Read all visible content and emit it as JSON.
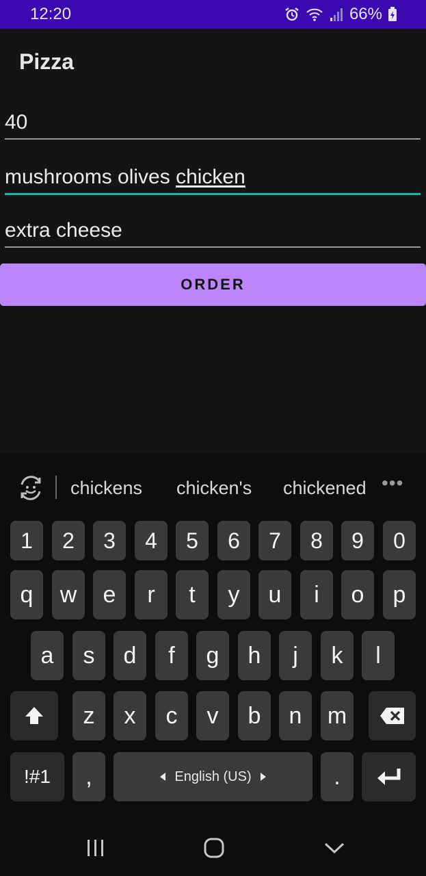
{
  "status_bar": {
    "time": "12:20",
    "battery": "66%",
    "icons": [
      "alarm-icon",
      "wifi-icon",
      "signal-icon",
      "battery-charging-icon"
    ]
  },
  "app": {
    "title": "Pizza"
  },
  "fields": {
    "quantity": "40",
    "toppings_prefix": "mushrooms olives ",
    "toppings_composing": "chicken",
    "extras": "extra cheese"
  },
  "order_button": {
    "label": "ORDER"
  },
  "keyboard": {
    "suggestions": [
      "chickens",
      "chicken's",
      "chickened"
    ],
    "more": "•••",
    "numbers": [
      "1",
      "2",
      "3",
      "4",
      "5",
      "6",
      "7",
      "8",
      "9",
      "0"
    ],
    "row1": [
      "q",
      "w",
      "e",
      "r",
      "t",
      "y",
      "u",
      "i",
      "o",
      "p"
    ],
    "row2": [
      "a",
      "s",
      "d",
      "f",
      "g",
      "h",
      "j",
      "k",
      "l"
    ],
    "row3": [
      "z",
      "x",
      "c",
      "v",
      "b",
      "n",
      "m"
    ],
    "symbols_label": "!#1",
    "comma": ",",
    "language": "English (US)",
    "period": "."
  },
  "colors": {
    "status_bar": "#3a0ab0",
    "button": "#bb86fc",
    "focus_underline": "#17b8a6",
    "background": "#151515"
  }
}
